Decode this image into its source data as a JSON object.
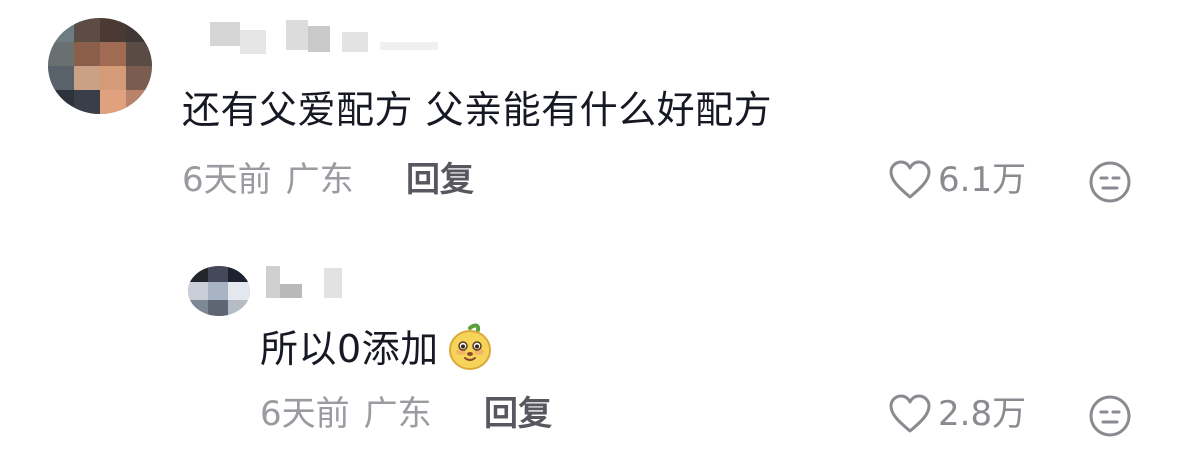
{
  "comments": [
    {
      "text": "还有父爱配方 父亲能有什么好配方",
      "time": "6天前",
      "location": "广东",
      "reply_label": "回复",
      "likes": "6.1万",
      "icons": {
        "like": "heart-outline-icon",
        "dislike": "neutral-face-icon"
      }
    }
  ],
  "replies": [
    {
      "text": "所以0添加",
      "emoji": "mango-face-emoji",
      "time": "6天前",
      "location": "广东",
      "reply_label": "回复",
      "likes": "2.8万",
      "icons": {
        "like": "heart-outline-icon",
        "dislike": "neutral-face-icon"
      }
    }
  ],
  "colors": {
    "text": "#161823",
    "meta": "#9a9aa0",
    "reply": "#57575f",
    "icon": "#8a8a90"
  }
}
